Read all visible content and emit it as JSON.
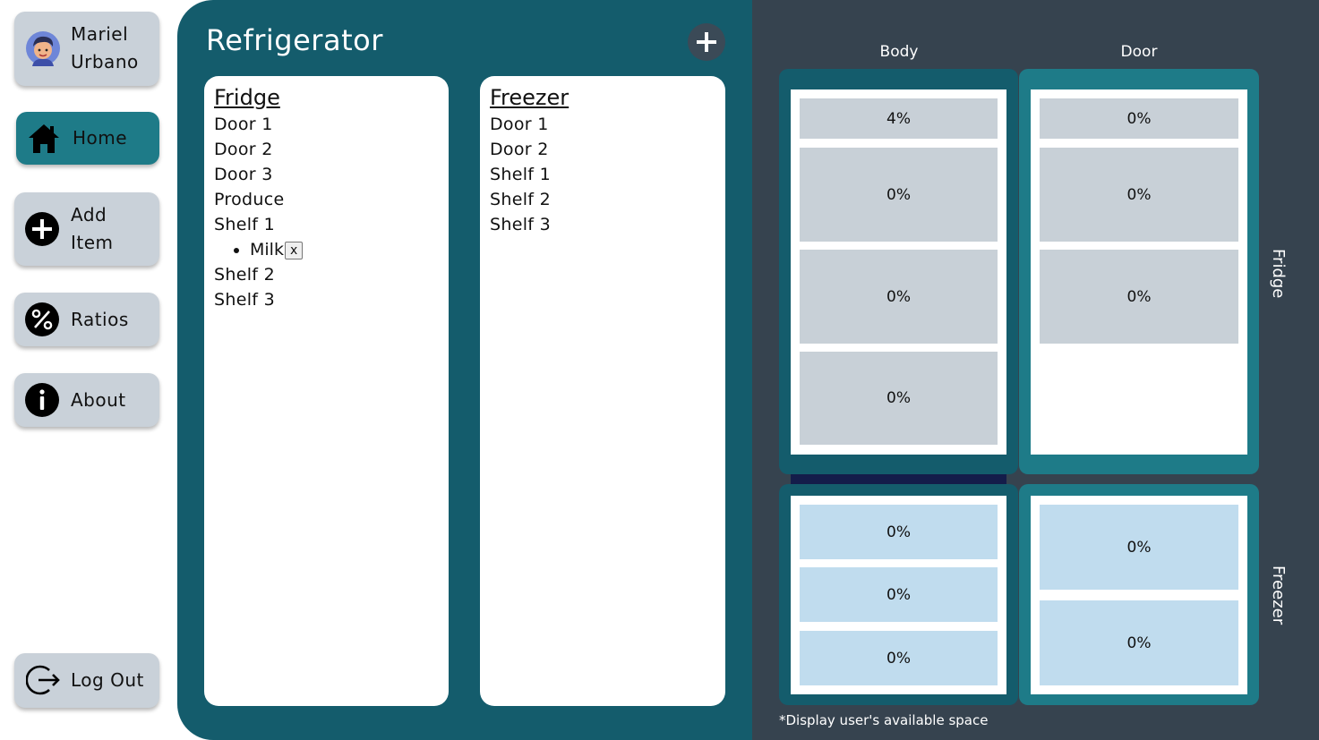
{
  "colors": {
    "panel_teal": "#145c6c",
    "active_teal": "#1e7b88",
    "right_bg": "#36434f",
    "nav_gray": "#c9d1d9",
    "cell_gray": "#c8d0d7",
    "cell_blue": "#c0dcee",
    "divider_navy": "#141c4a"
  },
  "sidebar": {
    "profile": {
      "first": "Mariel",
      "last": "Urbano",
      "icon": "avatar"
    },
    "home": {
      "label": "Home",
      "icon": "home-icon"
    },
    "add": {
      "line1": "Add",
      "line2": "Item",
      "icon": "plus-circle-icon"
    },
    "ratios": {
      "label": "Ratios",
      "icon": "percent-icon"
    },
    "about": {
      "label": "About",
      "icon": "info-icon"
    },
    "logout": {
      "label": "Log Out",
      "icon": "logout-icon"
    }
  },
  "main": {
    "title": "Refrigerator",
    "fridge": {
      "title": "Fridge",
      "compartments": [
        {
          "name": "Door 1",
          "items": []
        },
        {
          "name": "Door 2",
          "items": []
        },
        {
          "name": "Door 3",
          "items": []
        },
        {
          "name": "Produce",
          "items": []
        },
        {
          "name": "Shelf 1",
          "items": [
            {
              "name": "Milk",
              "remove": "x"
            }
          ]
        },
        {
          "name": "Shelf 2",
          "items": []
        },
        {
          "name": "Shelf 3",
          "items": []
        }
      ]
    },
    "freezer": {
      "title": "Freezer",
      "compartments": [
        {
          "name": "Door 1"
        },
        {
          "name": "Door 2"
        },
        {
          "name": "Shelf 1"
        },
        {
          "name": "Shelf 2"
        },
        {
          "name": "Shelf 3"
        }
      ]
    }
  },
  "display": {
    "col_body": "Body",
    "col_door": "Door",
    "row_fridge": "Fridge",
    "row_freezer": "Freezer",
    "fridge_body": [
      "4%",
      "0%",
      "0%",
      "0%"
    ],
    "fridge_door": [
      "0%",
      "0%",
      "0%"
    ],
    "freezer_body": [
      "0%",
      "0%",
      "0%"
    ],
    "freezer_door": [
      "0%",
      "0%"
    ],
    "footnote": "*Display user's available space"
  }
}
